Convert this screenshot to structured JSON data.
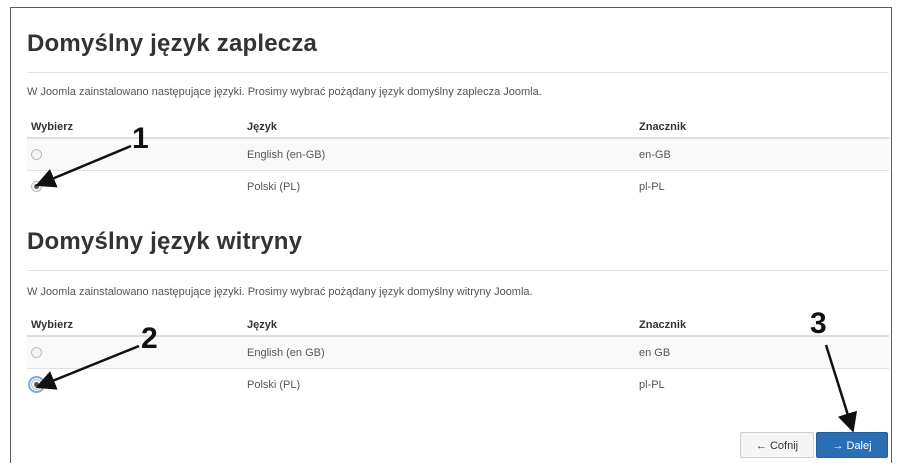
{
  "admin_section": {
    "title": "Domyślny język zaplecza",
    "description": "W Joomla zainstalowano następujące języki. Prosimy wybrać pożądany język domyślny zaplecza Joomla.",
    "headers": [
      "Wybierz",
      "Język",
      "Znacznik"
    ],
    "rows": [
      {
        "language": "English (en-GB)",
        "tag": "en-GB",
        "selected": false
      },
      {
        "language": "Polski (PL)",
        "tag": "pl-PL",
        "selected": true
      }
    ]
  },
  "site_section": {
    "title": "Domyślny język witryny",
    "description": "W Joomla zainstalowano następujące języki. Prosimy wybrać pożądany język domyślny witryny Joomla.",
    "headers": [
      "Wybierz",
      "Język",
      "Znacznik"
    ],
    "rows": [
      {
        "language": "English (en GB)",
        "tag": "en GB",
        "selected": false
      },
      {
        "language": "Polski (PL)",
        "tag": "pl-PL",
        "selected": true
      }
    ]
  },
  "annotations": [
    "1",
    "2",
    "3"
  ],
  "buttons": {
    "back": {
      "icon": "arrow-left-icon",
      "label": "← Cofnij"
    },
    "next": {
      "icon": "arrow-right-icon",
      "label": "→ Dalej"
    }
  },
  "colors": {
    "primary": "#2a6fb5",
    "text": "#333333",
    "muted": "#555555"
  }
}
